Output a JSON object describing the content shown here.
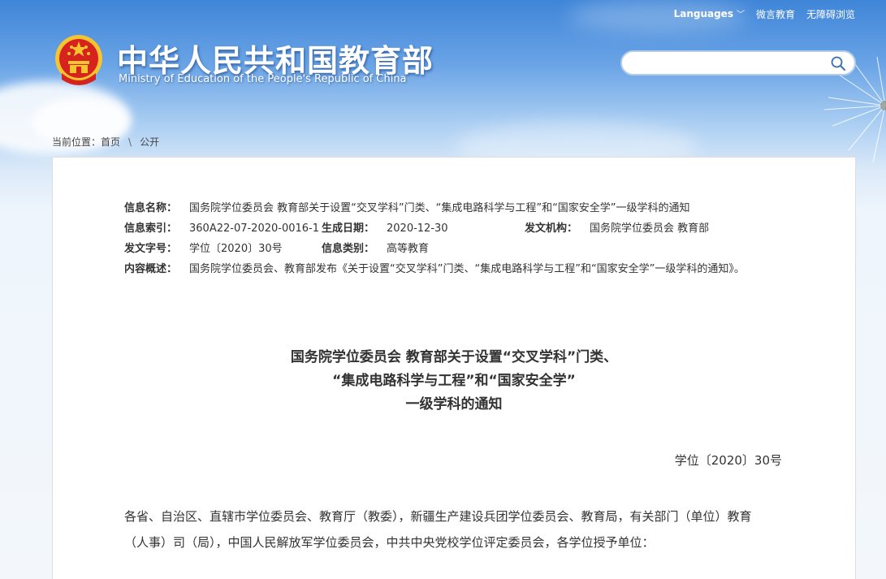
{
  "top_links": {
    "languages": "Languages",
    "languages_chevron": "﹀",
    "weixin": "微言教育",
    "accessibility": "无障碍浏览"
  },
  "header": {
    "title": "中华人民共和国教育部",
    "subtitle": "Ministry of Education of the People's Republic of China"
  },
  "search": {
    "placeholder": "",
    "value": ""
  },
  "breadcrumb": {
    "label": "当前位置：",
    "home": "首页",
    "separator": "\\",
    "current": "公开"
  },
  "meta": {
    "name_label": "信息名称：",
    "name_value": "国务院学位委员会 教育部关于设置“交叉学科”门类、“集成电路科学与工程”和“国家安全学”一级学科的通知",
    "index_label": "信息索引：",
    "index_value": "360A22-07-2020-0016-1",
    "date_label": "生成日期：",
    "date_value": "2020-12-30",
    "org_label": "发文机构：",
    "org_value": "国务院学位委员会 教育部",
    "number_label": "发文字号：",
    "number_value": "学位〔2020〕30号",
    "category_label": "信息类别：",
    "category_value": "高等教育",
    "summary_label": "内容概述：",
    "summary_value": "国务院学位委员会、教育部发布《关于设置“交叉学科”门类、“集成电路科学与工程”和“国家安全学”一级学科的通知》。"
  },
  "document": {
    "title_line1": "国务院学位委员会 教育部关于设置“交叉学科”门类、",
    "title_line2": "“集成电路科学与工程”和“国家安全学”",
    "title_line3": "一级学科的通知",
    "number": "学位〔2020〕30号",
    "recipients": "各省、自治区、直辖市学位委员会、教育厅（教委），新疆生产建设兵团学位委员会、教育局，有关部门（单位）教育（人事）司（局），中国人民解放军学位委员会，中共中央党校学位评定委员会，各学位授予单位："
  },
  "colors": {
    "sky_top": "#3f85d8",
    "panel_bg": "#ffffff",
    "text": "#333333",
    "emblem_red": "#d7231d",
    "emblem_gold": "#f4c431"
  },
  "icons": {
    "emblem": "national-emblem-icon",
    "search": "search-icon",
    "chevron": "chevron-down-icon"
  }
}
